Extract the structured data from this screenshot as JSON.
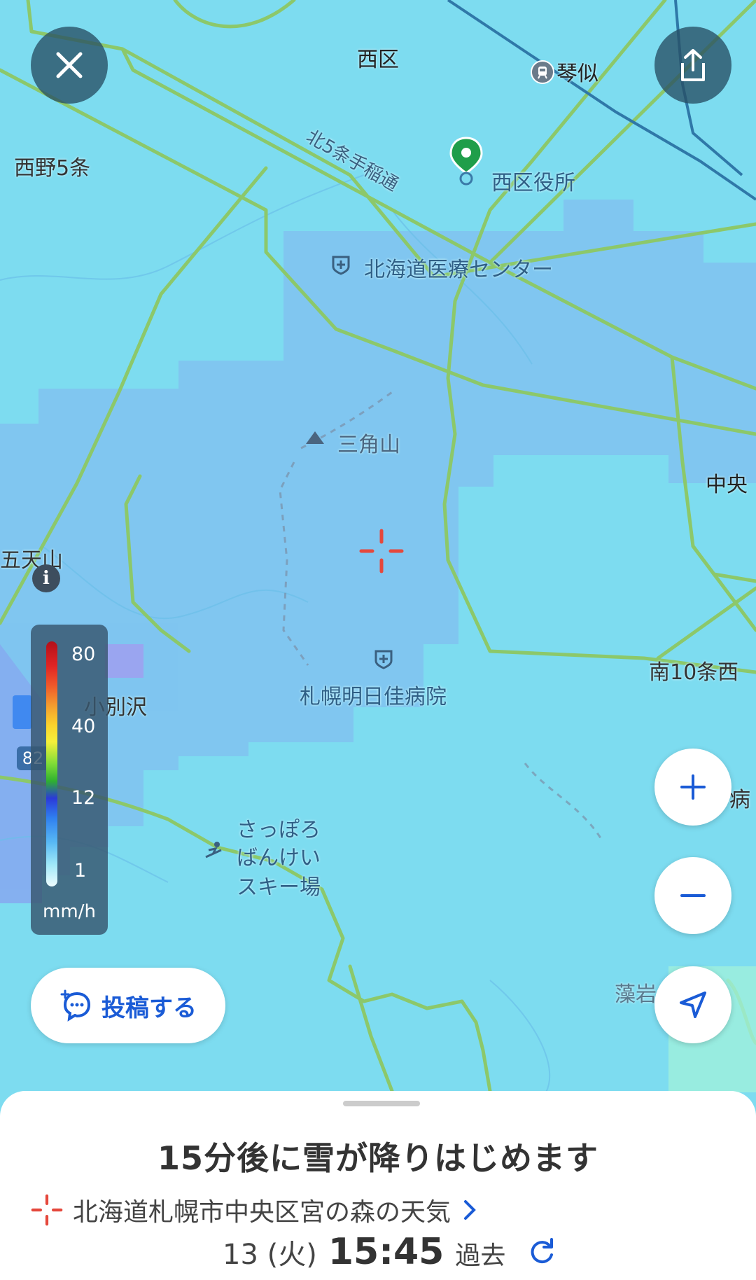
{
  "map": {
    "labels": {
      "nishi_ku": "西区",
      "kotoni": "琴似",
      "nishino5": "西野5条",
      "kita5_road": "北5条手稲通",
      "ward_office": "西区役所",
      "medical_center": "北海道医療センター",
      "sankakuyama": "三角山",
      "chuo": "中央",
      "gotenyama": "五天山",
      "kobetsuzawa": "小別沢",
      "minami10": "南10条西",
      "asuka_hospital": "札幌明日佳病院",
      "ski_line1": "さっぽろ",
      "ski_line2": "ばんけい",
      "ski_line3": "スキー場",
      "moiwa": "藻岩",
      "hospital_partial": "病",
      "route_number": "82"
    },
    "icons": [
      "close-icon",
      "share-icon",
      "location-pin-icon",
      "station-icon",
      "hospital-icon",
      "mountain-icon",
      "crosshair-icon",
      "info-icon",
      "zoom-in-icon",
      "zoom-out-icon",
      "navigation-arrow-icon",
      "ski-icon",
      "chat-post-icon",
      "refresh-icon",
      "chevron-right-icon"
    ]
  },
  "legend": {
    "ticks": [
      "80",
      "40",
      "12",
      "1"
    ],
    "unit": "mm/h"
  },
  "post_button": {
    "label": "投稿する"
  },
  "sheet": {
    "headline": "15分後に雪が降りはじめます",
    "place": "北海道札幌市中央区宮の森の天気",
    "date": "13 (火)",
    "time": "15:45",
    "mode": "過去"
  },
  "colors": {
    "map_light": "#7ddcf0",
    "precip_blue": "#80c2f0",
    "road_green": "#8cc86a",
    "accent_blue": "#1a5bd6",
    "crosshair_red": "#e5483c",
    "pin_green": "#1f9e4a"
  }
}
